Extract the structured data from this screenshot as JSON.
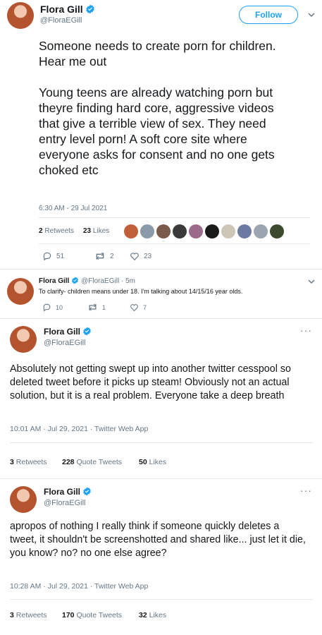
{
  "tweet1": {
    "name": "Flora Gill",
    "handle": "@FloraEGill",
    "follow_label": "Follow",
    "text": "Someone needs to create porn for children. Hear me out\n\nYoung teens are already watching porn but theyre finding hard core, aggressive videos that give a terrible view of sex. They need entry level porn! A soft core site where everyone asks for consent and no one gets choked etc",
    "timestamp": "6:30 AM - 29 Jul 2021",
    "retweets_count": "2",
    "retweets_label": "Retweets",
    "likes_count": "23",
    "likes_label": "Likes",
    "reply_count": "51",
    "retweet_action_count": "2",
    "like_action_count": "23"
  },
  "reply": {
    "name": "Flora Gill",
    "handle": "@FloraEGill",
    "time": "5m",
    "text": "To clarify- children means under 18. I'm talking about 14/15/16 year olds.",
    "reply_count": "10",
    "retweet_count": "1",
    "like_count": "7"
  },
  "tweet2": {
    "name": "Flora Gill",
    "handle": "@FloraEGill",
    "text": "Absolutely not getting swept up into another twitter cesspool so deleted tweet before it picks up steam! Obviously not an actual solution, but it is a real problem. Everyone take a deep breath",
    "timestamp": "10:01 AM · Jul 29, 2021 · Twitter Web App",
    "retweets_count": "3",
    "retweets_label": "Retweets",
    "quotes_count": "228",
    "quotes_label": "Quote Tweets",
    "likes_count": "50",
    "likes_label": "Likes",
    "more": "···"
  },
  "tweet3": {
    "name": "Flora Gill",
    "handle": "@FloraEGill",
    "text": "apropos of nothing I really think if someone quickly deletes a tweet, it shouldn't be screenshotted and shared like... just let it die, you know? no? no one else agree?",
    "timestamp": "10:28 AM · Jul 29, 2021 · Twitter Web App",
    "retweets_count": "3",
    "retweets_label": "Retweets",
    "quotes_count": "170",
    "quotes_label": "Quote Tweets",
    "likes_count": "32",
    "likes_label": "Likes",
    "more": "···"
  },
  "colors": {
    "accent": "#1da1f2",
    "muted": "#657786",
    "text": "#14171a"
  },
  "icons": [
    "verified-badge-icon",
    "chevron-down-icon",
    "reply-icon",
    "retweet-icon",
    "like-icon",
    "more-icon"
  ]
}
